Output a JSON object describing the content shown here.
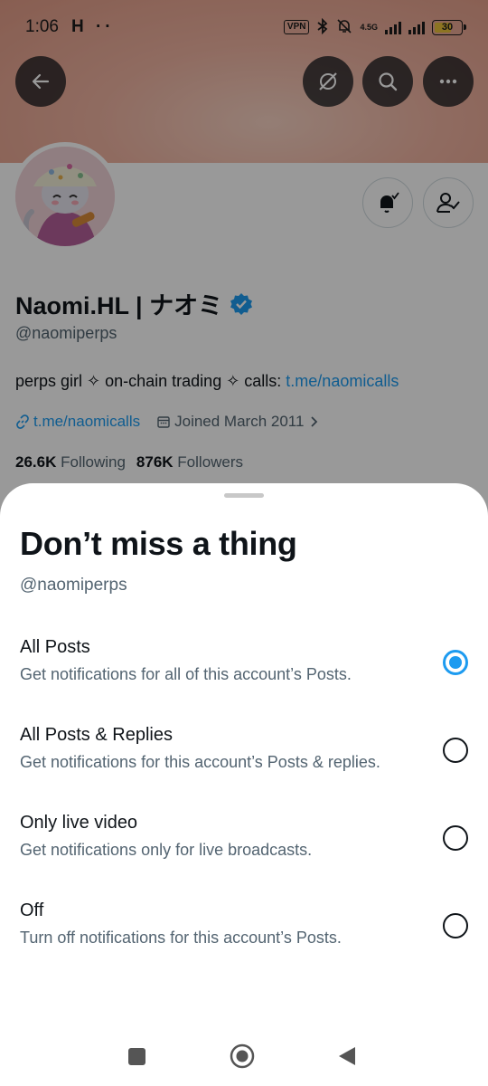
{
  "status_bar": {
    "time": "1:06",
    "left_icons": "H ··",
    "vpn": "VPN",
    "network": "4.5G",
    "battery": "30"
  },
  "profile": {
    "name": "Naomi.HL | ナオミ",
    "handle": "@naomiperps",
    "bio_text": "perps girl ✧ on-chain trading ✧ calls: ",
    "bio_link": "t.me/naomicalls",
    "website": "t.me/naomicalls",
    "joined": "Joined March 2011",
    "following_count": "26.6K",
    "following_label": "Following",
    "followers_count": "876K",
    "followers_label": "Followers"
  },
  "sheet": {
    "title": "Don’t miss a thing",
    "handle": "@naomiperps",
    "options": [
      {
        "title": "All Posts",
        "desc": "Get notifications for all of this account’s Posts.",
        "selected": true
      },
      {
        "title": "All Posts & Replies",
        "desc": "Get notifications for this account’s Posts & replies.",
        "selected": false
      },
      {
        "title": "Only live video",
        "desc": "Get notifications only for live broadcasts.",
        "selected": false
      },
      {
        "title": "Off",
        "desc": "Turn off notifications for this account’s Posts.",
        "selected": false
      }
    ]
  },
  "colors": {
    "accent": "#1d9bf0",
    "text": "#0f1419",
    "secondary": "#536471"
  }
}
